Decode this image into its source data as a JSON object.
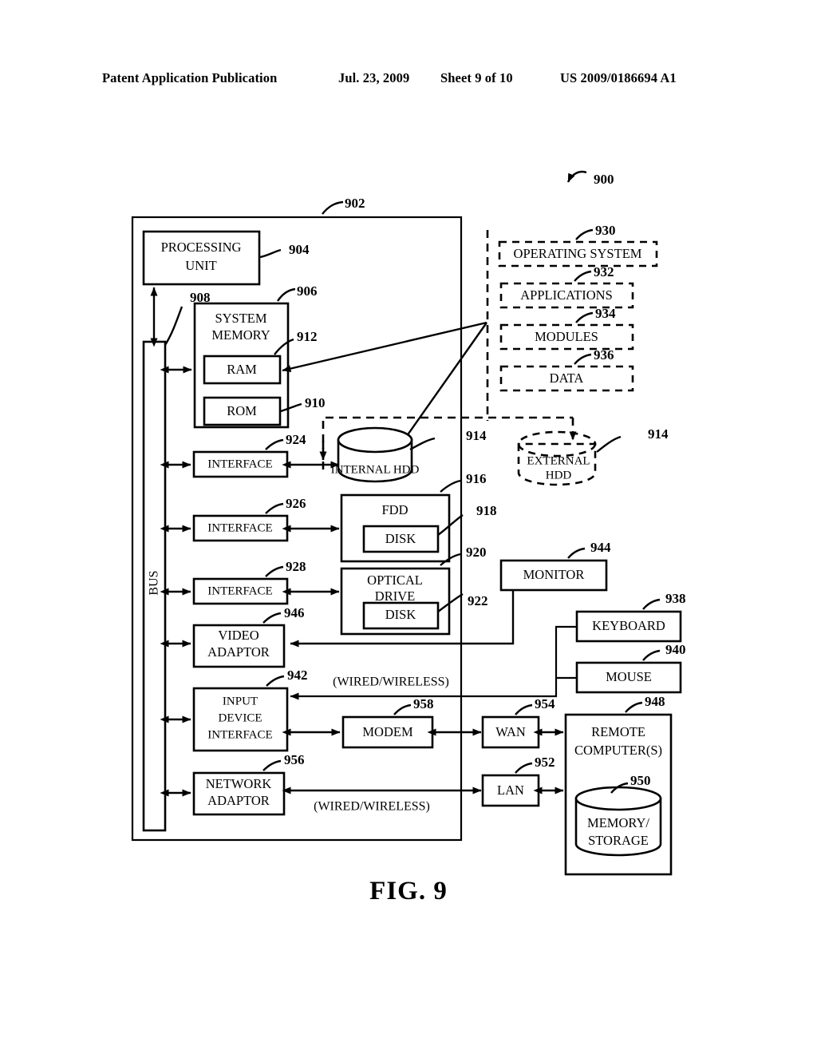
{
  "header": {
    "publication": "Patent Application Publication",
    "date": "Jul. 23, 2009",
    "sheet": "Sheet 9 of 10",
    "patent_number": "US 2009/0186694 A1"
  },
  "figure": {
    "caption": "FIG. 9",
    "overall_ref": "900",
    "blocks": {
      "computer_enclosure": {
        "ref": "902"
      },
      "processing_unit": {
        "label_line1": "PROCESSING",
        "label_line2": "UNIT",
        "ref": "904"
      },
      "system_memory": {
        "label_line1": "SYSTEM",
        "label_line2": "MEMORY",
        "ref": "906"
      },
      "bus": {
        "label": "BUS",
        "ref": "908"
      },
      "rom": {
        "label": "ROM",
        "ref": "910"
      },
      "ram": {
        "label": "RAM",
        "ref": "912"
      },
      "internal_hdd": {
        "label": "INTERNAL HDD",
        "ref": "914"
      },
      "external_hdd": {
        "label_line1": "EXTERNAL",
        "label_line2": "HDD",
        "ref": "914"
      },
      "fdd": {
        "label": "FDD",
        "ref": "916"
      },
      "fdd_disk": {
        "label": "DISK",
        "ref": "918"
      },
      "optical_drive": {
        "label_line1": "OPTICAL",
        "label_line2": "DRIVE",
        "ref": "920"
      },
      "optical_disk": {
        "label": "DISK",
        "ref": "922"
      },
      "interface_hdd": {
        "label": "INTERFACE",
        "ref": "924"
      },
      "interface_fdd": {
        "label": "INTERFACE",
        "ref": "926"
      },
      "interface_optical": {
        "label": "INTERFACE",
        "ref": "928"
      },
      "operating_system": {
        "label": "OPERATING SYSTEM",
        "ref": "930"
      },
      "applications": {
        "label": "APPLICATIONS",
        "ref": "932"
      },
      "modules": {
        "label": "MODULES",
        "ref": "934"
      },
      "data_store": {
        "label": "DATA",
        "ref": "936"
      },
      "keyboard": {
        "label": "KEYBOARD",
        "ref": "938"
      },
      "mouse": {
        "label": "MOUSE",
        "ref": "940"
      },
      "input_device_interface": {
        "label_line1": "INPUT",
        "label_line2": "DEVICE",
        "label_line3": "INTERFACE",
        "ref": "942"
      },
      "monitor": {
        "label": "MONITOR",
        "ref": "944"
      },
      "video_adaptor": {
        "label_line1": "VIDEO",
        "label_line2": "ADAPTOR",
        "ref": "946"
      },
      "remote_computers": {
        "label_line1": "REMOTE",
        "label_line2": "COMPUTER(S)",
        "ref": "948"
      },
      "memory_storage": {
        "label_line1": "MEMORY/",
        "label_line2": "STORAGE",
        "ref": "950"
      },
      "lan": {
        "label": "LAN",
        "ref": "952"
      },
      "wan": {
        "label": "WAN",
        "ref": "954"
      },
      "network_adaptor": {
        "label_line1": "NETWORK",
        "label_line2": "ADAPTOR",
        "ref": "956"
      },
      "modem": {
        "label": "MODEM",
        "ref": "958"
      }
    },
    "annotations": {
      "wired_wireless_upper": "(WIRED/WIRELESS)",
      "wired_wireless_lower": "(WIRED/WIRELESS)"
    }
  }
}
